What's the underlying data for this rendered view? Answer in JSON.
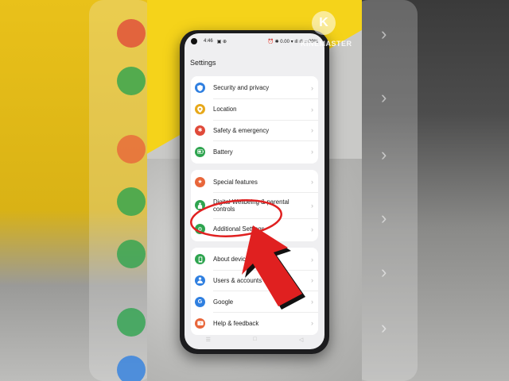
{
  "status": {
    "time": "4:46",
    "left_icons": "▣ ⊕",
    "right_icons": "⏰ ✱ 0.00 ▾ ıll ıll ▭29%",
    "battery": "29%"
  },
  "screen_title": "Settings",
  "groups": [
    {
      "items": [
        {
          "label": "Security and privacy",
          "icon": "shield-icon",
          "color": "#2f7fe0"
        },
        {
          "label": "Location",
          "icon": "location-pin-icon",
          "color": "#e7a81a"
        },
        {
          "label": "Safety & emergency",
          "icon": "asterisk-icon",
          "color": "#e04a3a"
        },
        {
          "label": "Battery",
          "icon": "battery-icon",
          "color": "#2ea44f"
        }
      ]
    },
    {
      "items": [
        {
          "label": "Special features",
          "icon": "star-icon",
          "color": "#e8663a"
        },
        {
          "label": "Digital Wellbeing & parental controls",
          "icon": "wellbeing-icon",
          "color": "#2ea44f"
        },
        {
          "label": "Additional Settings",
          "icon": "gear-icon",
          "color": "#2ea44f"
        }
      ]
    },
    {
      "items": [
        {
          "label": "About device",
          "icon": "phone-icon",
          "color": "#2ea44f"
        },
        {
          "label": "Users & accounts",
          "icon": "user-icon",
          "color": "#2f7fe0"
        },
        {
          "label": "Google",
          "icon": "google-icon",
          "color": "#2f7fe0"
        },
        {
          "label": "Help & feedback",
          "icon": "help-icon",
          "color": "#e8663a"
        }
      ]
    }
  ],
  "watermark": {
    "logo": "K",
    "text": "KINEMASTER"
  },
  "annotation": {
    "target": "Additional Settings",
    "highlight_color": "#e02020"
  }
}
